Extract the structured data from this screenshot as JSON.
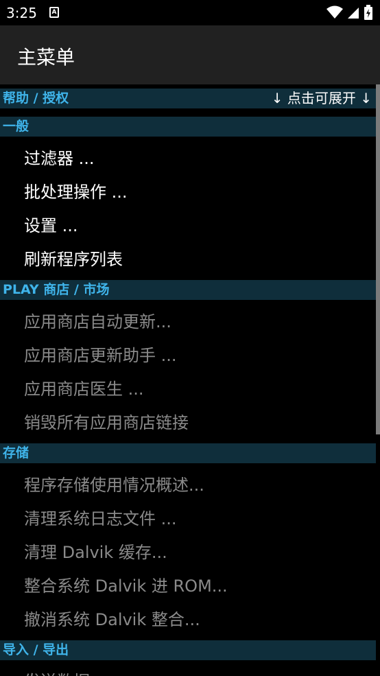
{
  "status_bar": {
    "time": "3:25",
    "notification_icon": "A",
    "icons": [
      "wifi-icon",
      "cell-signal-icon",
      "battery-icon"
    ]
  },
  "app_bar": {
    "title": "主菜单"
  },
  "colors": {
    "header_bg": "#0f2e3b",
    "header_text": "#3fb4ea",
    "dim_text": "#8a8a8a"
  },
  "sections": {
    "help": {
      "title": "帮助 / 授权",
      "hint": "↓ 点击可展开 ↓"
    },
    "general": {
      "title": "一般",
      "items": [
        "过滤器 ...",
        "批处理操作 ...",
        "设置 ...",
        "刷新程序列表"
      ]
    },
    "play_store": {
      "title": "PLAY 商店 / 市场",
      "items": [
        "应用商店自动更新...",
        "应用商店更新助手 ...",
        "应用商店医生 ...",
        "销毁所有应用商店链接"
      ]
    },
    "storage": {
      "title": "存储",
      "items": [
        "程序存储使用情况概述...",
        "清理系统日志文件 ...",
        "清理 Dalvik 缓存...",
        "整合系统 Dalvik 进 ROM...",
        "撤消系统 Dalvik 整合..."
      ]
    },
    "import_export": {
      "title": "导入 / 导出",
      "items": [
        "发送数据"
      ]
    }
  }
}
